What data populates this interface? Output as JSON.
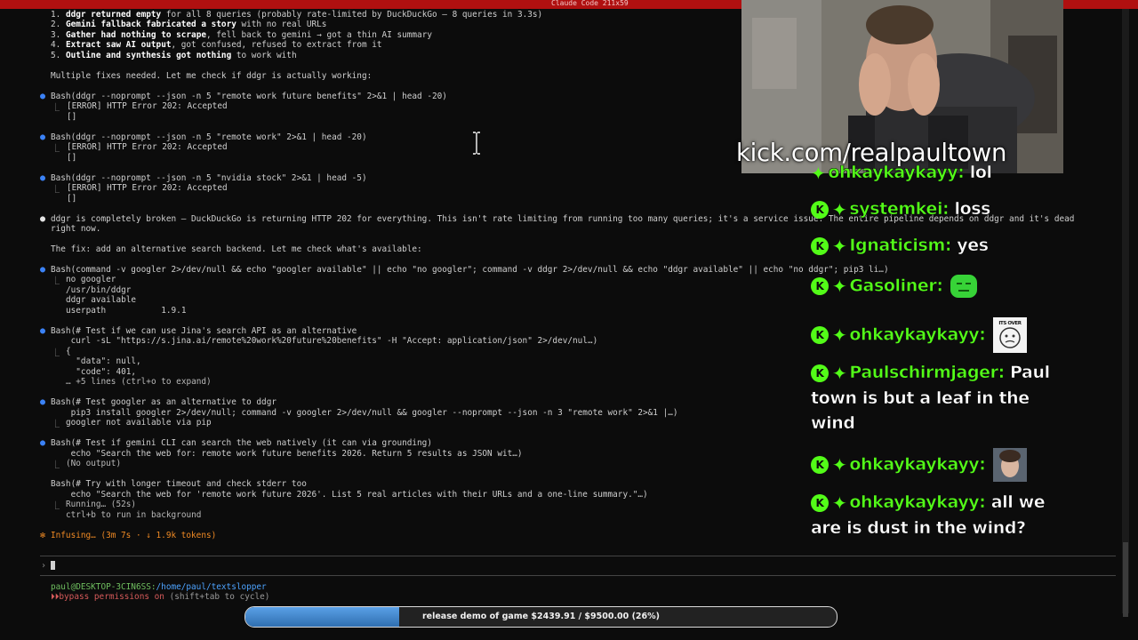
{
  "window": {
    "title": "Claude Code 211x59"
  },
  "terminal": {
    "summary": [
      {
        "num": "1.",
        "bold": "ddgr returned empty",
        "rest": " for all 8 queries (probably rate-limited by DuckDuckGo — 8 queries in 3.3s)"
      },
      {
        "num": "2.",
        "bold": "Gemini fallback fabricated a story",
        "rest": " with no real URLs"
      },
      {
        "num": "3.",
        "bold": "Gather had nothing to scrape",
        "rest": ", fell back to gemini → got a thin AI summary"
      },
      {
        "num": "4.",
        "bold": "Extract saw AI output",
        "rest": ", got confused, refused to extract from it"
      },
      {
        "num": "5.",
        "bold": "Outline and synthesis got nothing",
        "rest": " to work with"
      }
    ],
    "multiple_fixes": "Multiple fixes needed. Let me check if ddgr is actually working:",
    "bash1": {
      "cmd": "Bash(ddgr --noprompt --json -n 5 \"remote work future benefits\" 2>&1 | head -20)",
      "out1": "[ERROR] HTTP Error 202: Accepted",
      "out2": "[]"
    },
    "bash2": {
      "cmd": "Bash(ddgr --noprompt --json -n 5 \"remote work\" 2>&1 | head -20)",
      "out1": "[ERROR] HTTP Error 202: Accepted",
      "out2": "[]"
    },
    "bash3": {
      "cmd": "Bash(ddgr --noprompt --json -n 5 \"nvidia stock\" 2>&1 | head -5)",
      "out1": "[ERROR] HTTP Error 202: Accepted",
      "out2": "[]"
    },
    "broken_line1": "ddgr is completely broken — DuckDuckGo is returning HTTP 202 for everything. This isn't rate limiting from running too many queries; it's a service issue. The entire pipeline depends on ddgr and it's dead",
    "broken_line2": "right now.",
    "fix_line": "The fix: add an alternative search backend. Let me check what's available:",
    "bash4": {
      "cmd": "Bash(command -v googler 2>/dev/null && echo \"googler available\" || echo \"no googler\"; command -v ddgr 2>/dev/null && echo \"ddgr available\" || echo \"no ddgr\"; pip3 li…)",
      "out": [
        "no googler",
        "/usr/bin/ddgr",
        "ddgr available",
        "userpath           1.9.1"
      ]
    },
    "bash5": {
      "cmd": "Bash(# Test if we can use Jina's search API as an alternative",
      "cmd2": "    curl -sL \"https://s.jina.ai/remote%20work%20future%20benefits\" -H \"Accept: application/json\" 2>/dev/nul…)",
      "out": [
        "{",
        "  \"data\": null,",
        "  \"code\": 401,"
      ],
      "more": "… +5 lines (ctrl+o to expand)"
    },
    "bash6": {
      "cmd": "Bash(# Test googler as an alternative to ddgr",
      "cmd2": "    pip3 install googler 2>/dev/null; command -v googler 2>/dev/null && googler --noprompt --json -n 3 \"remote work\" 2>&1 |…)",
      "out": "googler not available via pip"
    },
    "bash7": {
      "cmd": "Bash(# Test if gemini CLI can search the web natively (it can via grounding)",
      "cmd2": "    echo \"Search the web for: remote work future benefits 2026. Return 5 results as JSON wit…)",
      "out": "(No output)"
    },
    "bash8": {
      "cmd": "Bash(# Try with longer timeout and check stderr too",
      "cmd2": "    echo \"Search the web for 'remote work future 2026'. List 5 real articles with their URLs and a one-line summary.\"…)",
      "out1": "Running… (52s)",
      "out2": "ctrl+b to run in background"
    },
    "status": "Infusing… (3m 7s · ↓ 1.9k tokens)",
    "user_host": "paul@DESKTOP-3CIN6SS:",
    "path": "/home/paul/textslopper",
    "bypass": "bypass permissions on",
    "bypass_hint": " (shift+tab to cycle)"
  },
  "stream": {
    "kick_url": "kick.com/realpaultown",
    "chat": [
      {
        "user": "ohkaykaykayy:",
        "text": "lol"
      },
      {
        "user": "systemkei:",
        "text": "loss"
      },
      {
        "user": "Ignaticism:",
        "text": "yes"
      },
      {
        "user": "Gasoliner:",
        "text": ""
      },
      {
        "user": "ohkaykaykayy:",
        "text": ""
      },
      {
        "user": "Paulschirmjager:",
        "text": "Paul town is but a leaf in the wind"
      },
      {
        "user": "ohkaykaykayy:",
        "text": ""
      },
      {
        "user": "ohkaykaykayy:",
        "text": "all we are is dust in the wind?"
      }
    ],
    "emote_text": "ITS OVER"
  },
  "goal": {
    "label": "release demo of game $2439.91 / $9500.00 (26%)",
    "progress": 0.26
  }
}
